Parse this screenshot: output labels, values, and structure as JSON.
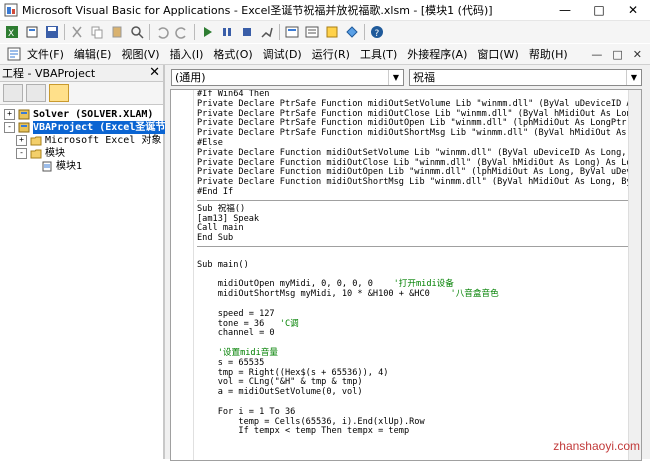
{
  "window": {
    "title": "Microsoft Visual Basic for Applications - Excel圣诞节祝福并放祝福歌.xlsm - [模块1 (代码)]",
    "controls": [
      "—",
      "□",
      "✕"
    ]
  },
  "menu": {
    "items": [
      {
        "label": "文件(F)"
      },
      {
        "label": "编辑(E)"
      },
      {
        "label": "视图(V)"
      },
      {
        "label": "插入(I)"
      },
      {
        "label": "格式(O)"
      },
      {
        "label": "调试(D)"
      },
      {
        "label": "运行(R)"
      },
      {
        "label": "工具(T)"
      },
      {
        "label": "外接程序(A)"
      },
      {
        "label": "窗口(W)"
      },
      {
        "label": "帮助(H)"
      }
    ],
    "right_controls": [
      "—",
      "□",
      "✕"
    ]
  },
  "project": {
    "header": "工程 - VBAProject",
    "close": "✕",
    "tree": [
      {
        "label": "Solver (SOLVER.XLAM)",
        "level": 0,
        "expander": "+",
        "style": "bold"
      },
      {
        "label": "VBAProject (Excel圣诞节",
        "level": 0,
        "expander": "-",
        "style": "selected"
      },
      {
        "label": "Microsoft Excel 对象",
        "level": 1,
        "expander": "+",
        "style": "normal"
      },
      {
        "label": "模块",
        "level": 1,
        "expander": "-",
        "style": "normal"
      },
      {
        "label": "模块1",
        "level": 2,
        "expander": "",
        "style": "normal"
      }
    ]
  },
  "editor": {
    "object_combo": "(通用)",
    "proc_combo": "祝福",
    "blocks": [
      [
        "#If Win64 Then",
        "Private Declare PtrSafe Function midiOutSetVolume Lib \"winmm.dll\" (ByVal uDeviceID As Lon",
        "Private Declare PtrSafe Function midiOutClose Lib \"winmm.dll\" (ByVal hMidiOut As LongPtr)",
        "Private Declare PtrSafe Function midiOutOpen Lib \"winmm.dll\" (lphMidiOut As LongPtr, ByVal",
        "Private Declare PtrSafe Function midiOutShortMsg Lib \"winmm.dll\" (ByVal hMidiOut As LongP",
        "#Else",
        "Private Declare Function midiOutSetVolume Lib \"winmm.dll\" (ByVal uDeviceID As Long, ByVal",
        "Private Declare Function midiOutClose Lib \"winmm.dll\" (ByVal hMidiOut As Long) As Long",
        "Private Declare Function midiOutOpen Lib \"winmm.dll\" (lphMidiOut As Long, ByVal uDeviceID",
        "Private Declare Function midiOutShortMsg Lib \"winmm.dll\" (ByVal hMidiOut As Long, ByVal d",
        "#End If"
      ],
      [
        "Sub 祝福()",
        "[am13] Speak",
        "Call main",
        "End Sub"
      ],
      [
        "",
        "Sub main()",
        "",
        "    midiOutOpen myMidi, 0, 0, 0, 0    '打开midi设备",
        "    midiOutShortMsg myMidi, 10 * &H100 + &HC0    '八音盒音色",
        "",
        "    speed = 127",
        "    tone = 36   'C调",
        "    channel = 0",
        "",
        "    '设置midi音量",
        "    s = 65535",
        "    tmp = Right((Hex$(s + 65536)), 4)",
        "    vol = CLng(\"&H\" & tmp & tmp)",
        "    a = midiOutSetVolume(0, vol)",
        "",
        "    For i = 1 To 36",
        "        temp = Cells(65536, i).End(xlUp).Row",
        "        If tempx < temp Then tempx = temp"
      ]
    ]
  },
  "watermark": "zhanshaoyi.com"
}
